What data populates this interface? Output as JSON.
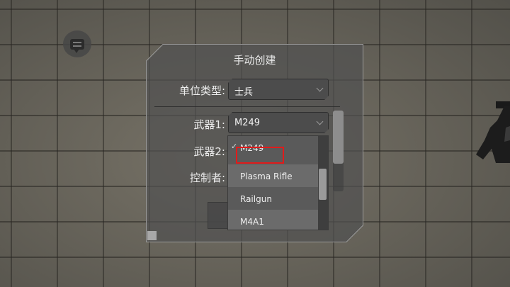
{
  "dialog": {
    "title": "手动创建",
    "unit_type_label": "单位类型:",
    "unit_type_value": "士兵",
    "weapon1_label": "武器1:",
    "weapon1_value": "M249",
    "weapon2_label": "武器2:",
    "controller_label": "控制者:"
  },
  "dropdown": {
    "options": [
      "M249",
      "Plasma Rifle",
      "Railgun",
      "M4A1"
    ],
    "selected": "M249",
    "check_glyph": "✓"
  },
  "icons": {
    "chat": "chat-bubble-icon",
    "chevron": "chevron-down-icon",
    "check": "checkmark-icon"
  },
  "colors": {
    "highlight": "#e11b1b",
    "panel": "#505050",
    "text": "#ececec"
  }
}
